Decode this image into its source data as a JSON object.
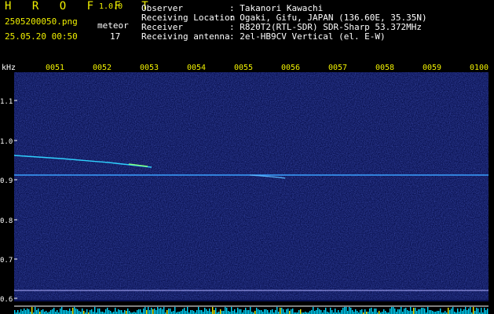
{
  "app": {
    "title": "H R O F F T",
    "version": "1.0.0"
  },
  "file": {
    "name": "2505200050.png",
    "datetime": "25.05.20 00:50"
  },
  "meteor": {
    "label": "meteor",
    "count": "17"
  },
  "info": [
    {
      "key": "Observer",
      "value": ": Takanori Kawachi"
    },
    {
      "key": "Receiving Location",
      "value": ": Ogaki, Gifu, JAPAN (136.60E, 35.35N)"
    },
    {
      "key": "Receiver",
      "value": ": R820T2(RTL-SDR) SDR-Sharp 53.372MHz"
    },
    {
      "key": "Receiving antenna",
      "value": ": 2el-HB9CV Vertical (el. E-W)"
    }
  ],
  "axis": {
    "unit": "kHz",
    "y_ticks": [
      "1.1",
      "1.0",
      "0.9",
      "0.8",
      "0.7",
      "0.6"
    ],
    "x_ticks": [
      "0051",
      "0052",
      "0053",
      "0054",
      "0055",
      "0056",
      "0057",
      "0058",
      "0059",
      "0100"
    ]
  },
  "colors": {
    "header_text": "#ffffff",
    "accent_yellow": "#f0f000",
    "plot_bg": "#0a0f5a",
    "signal": "#3aa0ff",
    "meter": "#00e0ff"
  }
}
